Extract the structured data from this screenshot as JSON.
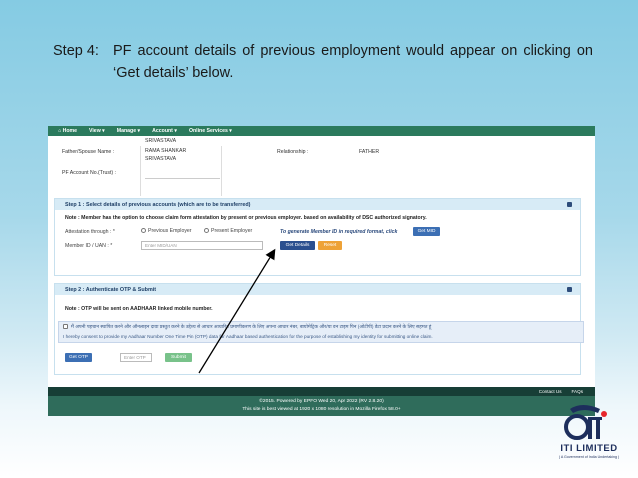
{
  "slide": {
    "step_label": "Step 4:",
    "step_text": "PF account details of previous employment would appear on clicking on ‘Get details’ below."
  },
  "nav": {
    "items": [
      "Home",
      "View ▾",
      "Manage ▾",
      "Account ▾",
      "Online Services ▾"
    ]
  },
  "profile": {
    "name_tail": "SRIVASTAVA",
    "father_label": "Father/Spouse Name :",
    "father_value_1": "RAMA SHANKAR",
    "father_value_2": "SRIVASTAVA",
    "relationship_label": "Relationship :",
    "relationship_value": "FATHER",
    "pf_account_label": "PF Account No.(Trust) :"
  },
  "step1": {
    "title": "Step 1 : Select details of previous accounts (which are to be transferred)",
    "note": "Note : Member has the option to choose claim form attestation by present or previous employer. based on availability of DSC authorized signatory.",
    "attestation_label": "Attestation through : *",
    "option_previous": "Previous Employer",
    "option_present": "Present Employer",
    "generate_hint": "To generate Member ID in required format, click",
    "get_mid_button": "Get MID",
    "member_id_label": "Member ID / UAN : *",
    "member_id_placeholder": "Enter MID/UAN",
    "get_details_button": "Get Details",
    "reset_button": "Reset"
  },
  "step2": {
    "title": "Step 2 : Authenticate OTP & Submit",
    "note": "Note : OTP will be sent on AADHAAR linked mobile number.",
    "consent_hindi": "मैं अपनी पहचान स्थापित करने और ऑनलाइन दावा प्रस्तुत करने के उद्देश्य से आधार आधारित प्रमाणीकरण के लिए अपना आधार नंबर, बायोमेट्रिक और/या वन टाइम पिन (ओटीपी) डेटा प्रदान करने के लिए सहमत हूं",
    "consent_english": "I hereby consent to provide my Aadhaar Number One Time Pin (OTP) data for Aadhaar based authentication for the purpose of establishing my identity for submitting online claim.",
    "get_otp_button": "Get OTP",
    "otp_placeholder": "Enter OTP",
    "submit_button": "Submit"
  },
  "footer": {
    "contact": "Contact Us",
    "faqs": "FAQs",
    "line1": "©2015. Powered by EPFO Wed 20, Apr 2022 (RV 2.8.20)",
    "line2": "This site is best viewed at 1920 x 1080 resolution in Mozilla Firefox 58.0+"
  },
  "logo": {
    "name": "ITI LIMITED",
    "tagline": "( A Government of India Undertaking )"
  },
  "colors": {
    "nav_green": "#2b7a5d",
    "panel_blue": "#d7ebf6",
    "button_blue": "#3c6fb4",
    "button_orange": "#eea237",
    "button_green": "#78c28a"
  }
}
